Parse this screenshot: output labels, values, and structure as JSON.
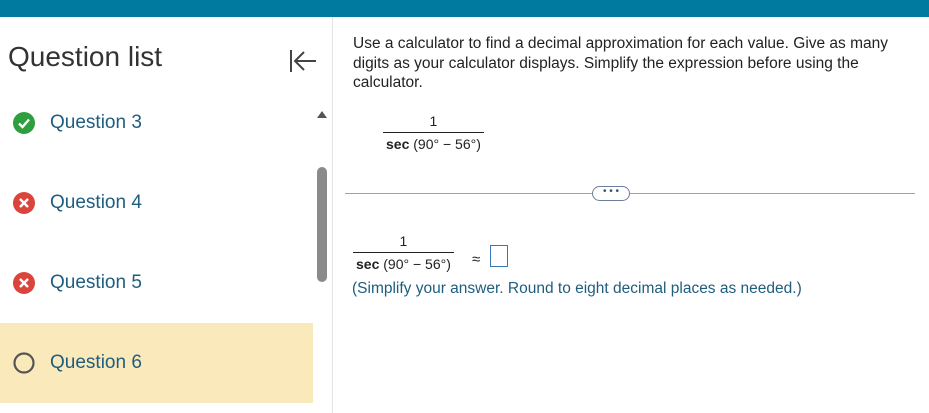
{
  "sidebar": {
    "title": "Question list",
    "items": [
      {
        "label": "Question 3",
        "status": "correct"
      },
      {
        "label": "Question 4",
        "status": "incorrect"
      },
      {
        "label": "Question 5",
        "status": "incorrect"
      },
      {
        "label": "Question 6",
        "status": "current"
      }
    ]
  },
  "question": {
    "instructions": "Use a calculator to find a decimal approximation for each value. Give as many digits as your calculator displays. Simplify the expression before using the calculator.",
    "expression": {
      "numerator": "1",
      "denominator_func": "sec",
      "denominator_arg": "(90° − 56°)"
    },
    "more_button": "• • •",
    "answer": {
      "numerator": "1",
      "denominator_func": "sec",
      "denominator_arg": "(90° − 56°)",
      "approx_symbol": "≈",
      "value": ""
    },
    "hint": "(Simplify your answer. Round to eight decimal places as needed.)"
  },
  "colors": {
    "topbar": "#007a9e",
    "correct": "#2e9e3e",
    "incorrect": "#d9453d",
    "current_bg": "#faeabb",
    "link": "#1f5d7e"
  }
}
